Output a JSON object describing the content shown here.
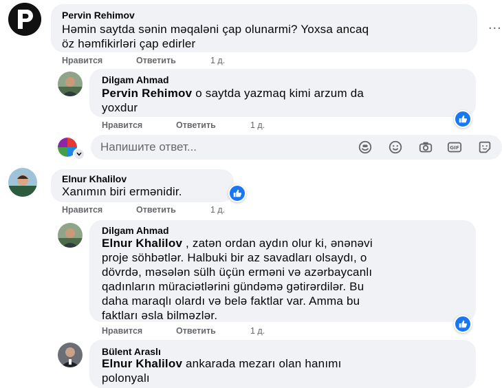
{
  "comments": [
    {
      "author": "Pervin Rehimov",
      "text_line1": "Həmin saytda sənin məqaləni çap olunarmi? Yoxsa ancaq",
      "text_line2": "öz həmfikirləri çap edirler",
      "like": "Нравится",
      "reply": "Ответить",
      "time": "1 д."
    },
    {
      "author": "Dilgam Ahmad",
      "mention": "Pervin Rehimov",
      "text_line1": " o saytda yazmaq kimi arzum da",
      "text_line2": "yoxdur",
      "like": "Нравится",
      "reply": "Ответить",
      "time": "1 д."
    },
    {
      "author": "Elnur Khalilov",
      "text_line1": "Xanımın biri ermənidir.",
      "like": "Нравится",
      "reply": "Ответить",
      "time": "1 д."
    },
    {
      "author": "Dilgam Ahmad",
      "mention": "Elnur Khalilov",
      "text_line1": " , zatən ordan aydın olur ki, ənənəvi",
      "text_line2": "proje söhbətlər. Halbuki bir az savadları olsaydı, o",
      "text_line3": "dövrdə, məsələn sülh üçün erməni və azərbaycanlı",
      "text_line4": "qadınların müraciətlərini gündəmə gətirərdilər. Bu",
      "text_line5": "daha maraqlı olardı və belə faktlar var. Amma bu",
      "text_line6": "faktları əsla bilməzlər.",
      "like": "Нравится",
      "reply": "Ответить",
      "time": "1 д."
    },
    {
      "author": "Bülent Araslı",
      "mention": "Elnur Khalilov",
      "text_line1": " ankarada mezarı olan hanımı",
      "text_line2": "polonyalı"
    }
  ],
  "reply_input": {
    "placeholder": "Напишите ответ..."
  },
  "more_options": "...",
  "colors": {
    "like_blue": "#1877f2",
    "bubble": "#f0f2f5",
    "meta": "#65676b"
  }
}
